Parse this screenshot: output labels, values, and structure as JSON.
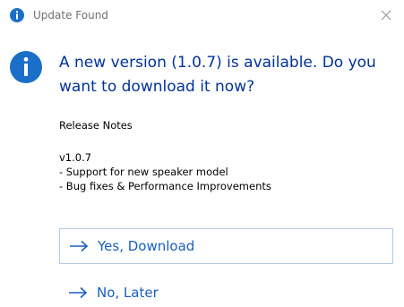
{
  "window": {
    "title": "Update Found"
  },
  "dialog": {
    "main_instruction": "A new version (1.0.7) is available. Do you want to download it now?",
    "release_notes_heading": "Release Notes",
    "release_notes_body": "v1.0.7\n- Support for new speaker model\n- Bug fixes & Performance Improvements"
  },
  "commands": {
    "yes_label": "Yes, Download",
    "no_label": "No, Later"
  },
  "colors": {
    "info_blue": "#1b6fc8",
    "instruction_text": "#003399",
    "link_text": "#1a5fbf"
  },
  "icons": {
    "title": "info-icon",
    "main": "info-icon",
    "command": "arrow-right-icon",
    "close": "close-icon"
  }
}
